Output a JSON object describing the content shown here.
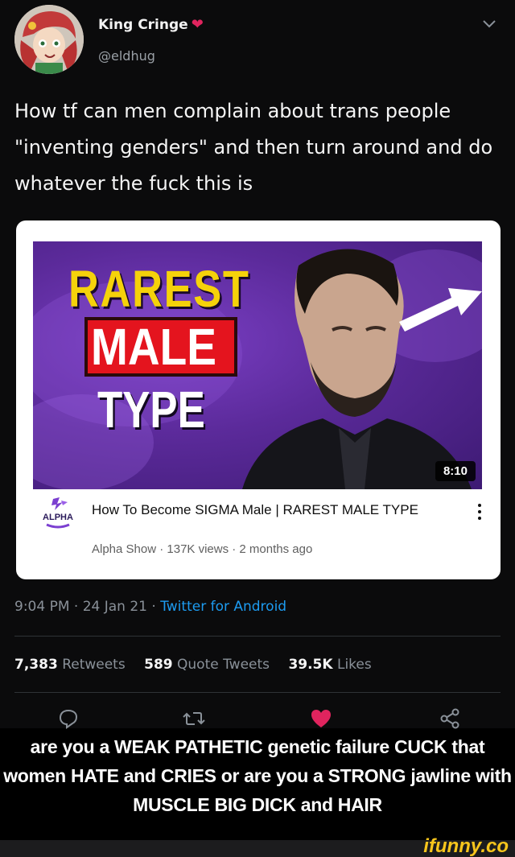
{
  "tweet": {
    "author": {
      "display_name": "King Cringe",
      "handle": "@eldhug",
      "name_emoji": "heart-emoji"
    },
    "text": "How tf can men complain about trans people \"inventing genders\" and then turn around and do whatever the fuck this is",
    "card": {
      "thumbnail": {
        "line1": "RAREST",
        "line2": "MALE",
        "line3": "TYPE",
        "duration": "8:10"
      },
      "channel_logo_text": "ALPHA",
      "video_title": "How To Become SIGMA Male | RAREST MALE TYPE",
      "video_meta": "Alpha Show · 137K views · 2 months ago"
    },
    "timestamp": {
      "time_date": "9:04 PM · 24 Jan 21 · ",
      "source": "Twitter for Android"
    },
    "stats": {
      "retweets_count": "7,383",
      "retweets_label": "Retweets",
      "quotes_count": "589",
      "quotes_label": "Quote Tweets",
      "likes_count": "39.5K",
      "likes_label": "Likes"
    },
    "actions": [
      "reply-icon",
      "retweet-icon",
      "like-icon",
      "share-icon"
    ],
    "colors": {
      "link_blue": "#1d9bf0",
      "like_red": "#e0245e",
      "thumb_yellow": "#f5d20a",
      "thumb_red": "#e4141e"
    }
  },
  "caption": "are you a WEAK PATHETIC genetic failure CUCK that women HATE and CRIES or are you a STRONG jawline with MUSCLE BIG DICK and HAIR",
  "watermark": "ifunny.co"
}
